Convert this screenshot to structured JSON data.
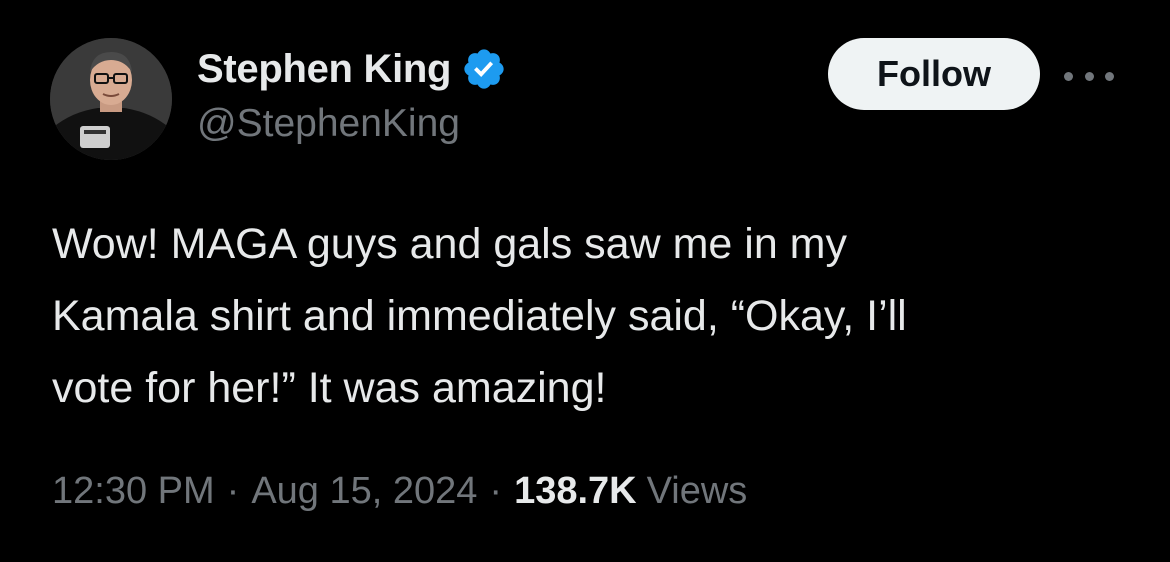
{
  "author": {
    "display_name": "Stephen King",
    "handle": "@StephenKing",
    "verified": true,
    "verified_color": "#1d9bf0"
  },
  "actions": {
    "follow_label": "Follow",
    "more_icon": "more-horizontal-icon"
  },
  "tweet": {
    "lines": [
      "Wow! MAGA guys and gals saw me in my",
      "Kamala shirt and immediately said, “Okay, I’ll",
      "vote for her!” It was amazing!"
    ]
  },
  "meta": {
    "time": "12:30 PM",
    "separator": "·",
    "date": "Aug 15, 2024",
    "views_count": "138.7K",
    "views_label": "Views"
  }
}
